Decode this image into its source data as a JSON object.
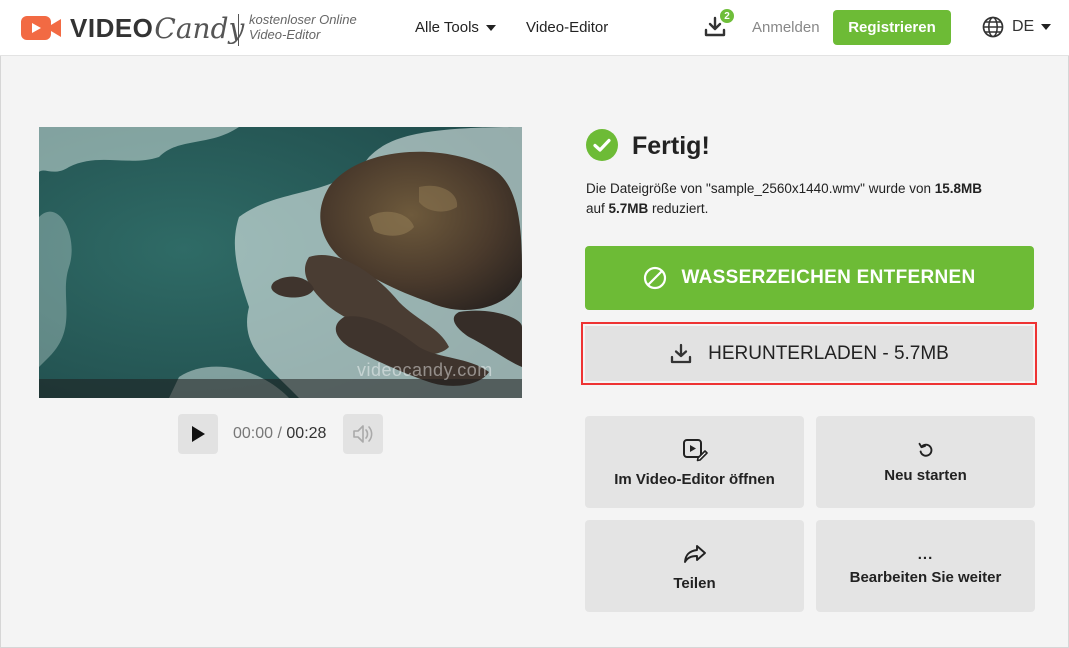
{
  "header": {
    "logo_video": "VIDEO",
    "logo_candy": "Candy",
    "tagline_line1": "kostenloser Online",
    "tagline_line2": "Video-Editor",
    "nav_tools_label": "Alle Tools",
    "nav_editor_label": "Video-Editor",
    "downloads_badge": "2",
    "login_label": "Anmelden",
    "register_label": "Registrieren",
    "language": "DE"
  },
  "player": {
    "watermark": "videocandy.com",
    "current_time": "00:00",
    "separator": " / ",
    "total_time": "00:28"
  },
  "result": {
    "title": "Fertig!",
    "desc_prefix": "Die Dateigröße von \"sample_2560x1440.wmv\" wurde von ",
    "size_before": "15.8MB",
    "desc_middle_1": "auf ",
    "size_after": "5.7MB",
    "desc_suffix": " reduziert.",
    "remove_watermark_label": "WASSERZEICHEN ENTFERNEN",
    "download_label": "HERUNTERLADEN - 5.7MB"
  },
  "tiles": {
    "open_editor": "Im Video-Editor öffnen",
    "restart": "Neu starten",
    "share": "Teilen",
    "more_icon": "...",
    "continue_editing": "Bearbeiten Sie weiter"
  },
  "colors": {
    "accent_green": "#6dbb36",
    "highlight_red": "#e33333",
    "logo_orange": "#f26a43"
  },
  "icons": [
    "video-camera-logo-icon",
    "chevron-down-icon",
    "download-icon",
    "globe-icon",
    "check-circle-icon",
    "play-icon",
    "volume-icon",
    "no-watermark-icon",
    "video-edit-icon",
    "restart-icon",
    "share-icon"
  ]
}
